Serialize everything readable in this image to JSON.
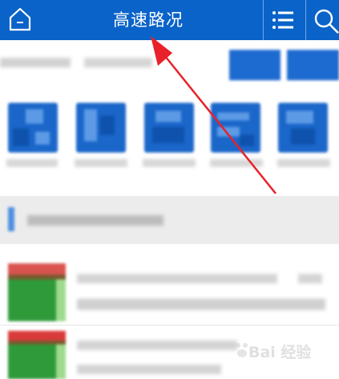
{
  "header": {
    "title": "高速路况",
    "icons": {
      "home": "home-icon",
      "menu": "list-menu-icon",
      "search": "search-icon"
    },
    "background": "#0a63c9"
  },
  "annotation": {
    "type": "red-arrow",
    "color": "#e8212a"
  },
  "watermark": {
    "text": "Bai 经验"
  },
  "colors": {
    "tile_blue": "#1a66c9",
    "band_gray": "#ececec",
    "thumb_red": "#d9534f",
    "thumb_green": "#2e9a3a"
  }
}
